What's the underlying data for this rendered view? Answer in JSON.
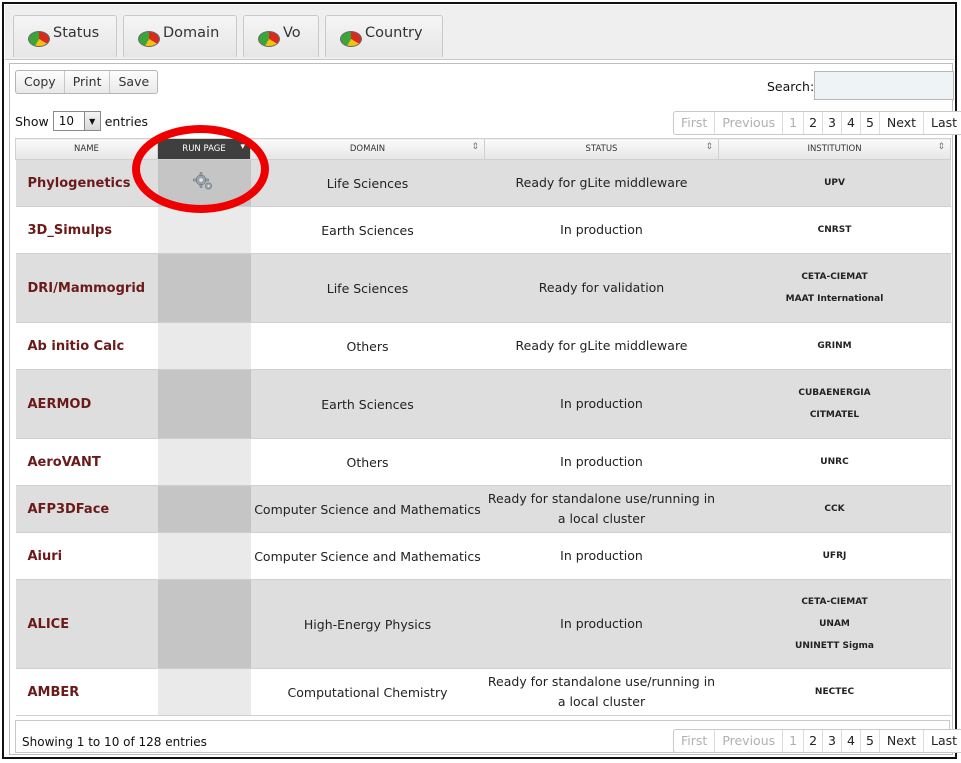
{
  "tabs": [
    {
      "label": "Status",
      "icon": "pie-chart-icon"
    },
    {
      "label": "Domain",
      "icon": "pie-chart-icon"
    },
    {
      "label": "Vo",
      "icon": "pie-chart-icon"
    },
    {
      "label": "Country",
      "icon": "pie-chart-icon"
    }
  ],
  "toolbar": {
    "copy": "Copy",
    "print": "Print",
    "save": "Save"
  },
  "search": {
    "label": "Search:",
    "value": ""
  },
  "length": {
    "show": "Show",
    "value": "10",
    "entries": "entries"
  },
  "pagination": {
    "first": "First",
    "previous": "Previous",
    "pages": [
      "1",
      "2",
      "3",
      "4",
      "5"
    ],
    "next": "Next",
    "last": "Last",
    "current": "1"
  },
  "columns": {
    "name": "NAME",
    "run": "RUN PAGE",
    "domain": "DOMAIN",
    "status": "STATUS",
    "institution": "INSTITUTION"
  },
  "rows": [
    {
      "name": "Phylogenetics",
      "run": "gear",
      "domain": "Life Sciences",
      "status": "Ready for gLite middleware",
      "institutions": [
        "UPV"
      ]
    },
    {
      "name": "3D_Simulps",
      "run": "",
      "domain": "Earth Sciences",
      "status": "In production",
      "institutions": [
        "CNRST"
      ]
    },
    {
      "name": "DRI/Mammogrid",
      "run": "",
      "domain": "Life Sciences",
      "status": "Ready for validation",
      "institutions": [
        "CETA-CIEMAT",
        "MAAT International"
      ]
    },
    {
      "name": "Ab initio Calc",
      "run": "",
      "domain": "Others",
      "status": "Ready for gLite middleware",
      "institutions": [
        "GRINM"
      ]
    },
    {
      "name": "AERMOD",
      "run": "",
      "domain": "Earth Sciences",
      "status": "In production",
      "institutions": [
        "CUBAENERGIA",
        "CITMATEL"
      ]
    },
    {
      "name": "AeroVANT",
      "run": "",
      "domain": "Others",
      "status": "In production",
      "institutions": [
        "UNRC"
      ]
    },
    {
      "name": "AFP3DFace",
      "run": "",
      "domain": "Computer Science and Mathematics",
      "status": "Ready for standalone use/running in a local cluster",
      "status_lines": [
        "Ready for standalone use/running in",
        "a local cluster"
      ],
      "institutions": [
        "CCK"
      ]
    },
    {
      "name": "Aiuri",
      "run": "",
      "domain": "Computer Science and Mathematics",
      "status": "In production",
      "institutions": [
        "UFRJ"
      ]
    },
    {
      "name": "ALICE",
      "run": "",
      "domain": "High-Energy Physics",
      "status": "In production",
      "institutions": [
        "CETA-CIEMAT",
        "UNAM",
        "UNINETT Sigma"
      ]
    },
    {
      "name": "AMBER",
      "run": "",
      "domain": "Computational Chemistry",
      "status": "Ready for standalone use/running in a local cluster",
      "status_lines": [
        "Ready for standalone use/running in",
        "a local cluster"
      ],
      "institutions": [
        "NECTEC"
      ]
    }
  ],
  "footer": {
    "info": "Showing 1 to 10 of 128 entries"
  },
  "colors": {
    "name_link": "#6b1a1a",
    "highlight_circle": "#ee0000",
    "run_header": "#3f3f3f"
  }
}
